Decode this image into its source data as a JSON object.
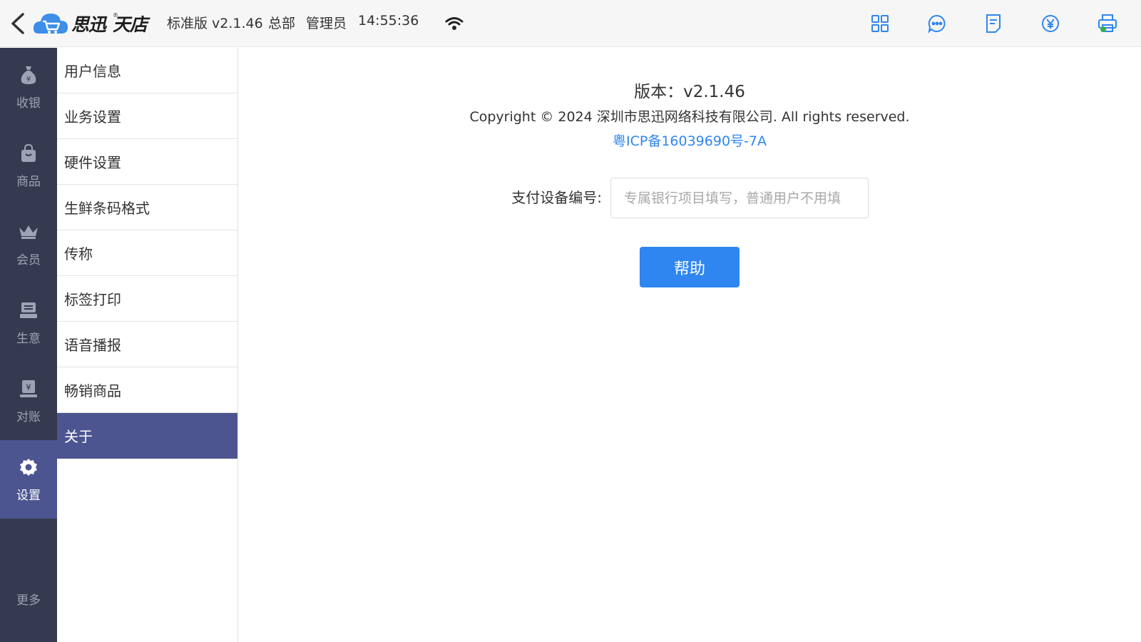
{
  "header": {
    "logo_text": "思迅",
    "logo_text2": "天店",
    "logo_reg": "®",
    "edition": "标准版 v2.1.46",
    "branch": "总部",
    "role": "管理员",
    "time": "14:55:36",
    "icons": [
      "grid-icon",
      "chat-icon",
      "document-icon",
      "yuan-icon",
      "printer-icon"
    ],
    "accent_color": "#2f86f0"
  },
  "leftnav": {
    "items": [
      {
        "label": "收银",
        "icon": "money-bag-icon"
      },
      {
        "label": "商品",
        "icon": "shopping-bag-icon"
      },
      {
        "label": "会员",
        "icon": "crown-icon"
      },
      {
        "label": "生意",
        "icon": "register-icon"
      },
      {
        "label": "对账",
        "icon": "reconcile-icon"
      },
      {
        "label": "设置",
        "icon": "gear-icon",
        "active": true
      }
    ],
    "more": "更多",
    "bg_color": "#363a50",
    "active_color": "#4c5590"
  },
  "submenu": {
    "items": [
      {
        "label": "用户信息"
      },
      {
        "label": "业务设置"
      },
      {
        "label": "硬件设置"
      },
      {
        "label": "生鲜条码格式"
      },
      {
        "label": "传称"
      },
      {
        "label": "标签打印"
      },
      {
        "label": "语音播报"
      },
      {
        "label": "畅销商品"
      },
      {
        "label": "关于",
        "active": true
      }
    ]
  },
  "about": {
    "version": "版本：v2.1.46",
    "copyright": "Copyright © 2024 深圳市思迅网络科技有限公司. All rights reserved.",
    "icp": "粤ICP备16039690号-7A",
    "device_label": "支付设备编号:",
    "device_value": "",
    "device_placeholder": "专属银行项目填写，普通用户不用填",
    "help_label": "帮助"
  }
}
